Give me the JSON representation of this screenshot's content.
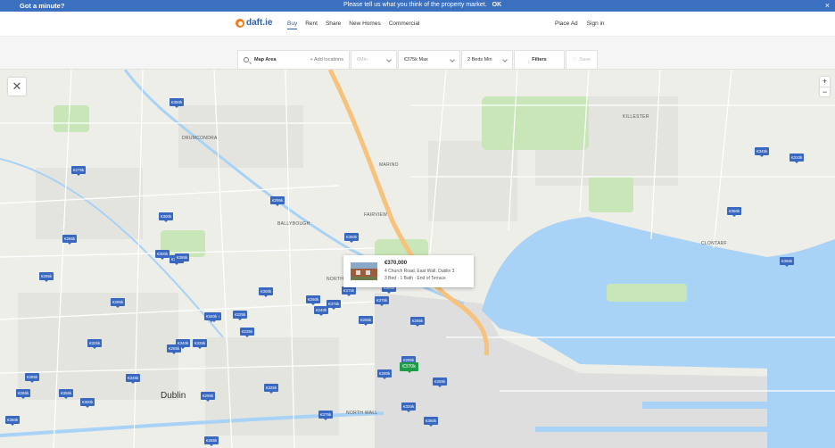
{
  "banner": {
    "left_text": "Got a minute?",
    "message": "Please tell us what you think of the property market.",
    "ok_label": "OK",
    "close_glyph": "×"
  },
  "header": {
    "logo_text": "daft.ie",
    "nav_left": [
      "Buy",
      "Rent",
      "Share",
      "New Homes",
      "Commercial"
    ],
    "nav_right": [
      "Place Ad",
      "Sign in"
    ],
    "active_nav": "Buy"
  },
  "filters": {
    "search_tag": "Map Area",
    "add_locations": "+ Add locations",
    "price_min": "€Min",
    "price_max": "€375k Max",
    "beds_min": "2 Beds Min",
    "filters_label": "Filters",
    "save_label": "Save"
  },
  "map": {
    "close_glyph": "✕",
    "zoom_in": "+",
    "zoom_out": "−",
    "labels": [
      "DRUMCONDRA",
      "MARINO",
      "KILLESTER",
      "FAIRVIEW",
      "BALLYBOUGH",
      "NORTH STRAND",
      "CLONTARF",
      "Dublin",
      "NORTH WALL"
    ],
    "pins": [
      "€350k",
      "€275k",
      "€300k",
      "€265k",
      "€295k",
      "€300k",
      "€375k",
      "€365k",
      "€350k",
      "€310k",
      "€295k",
      "€345k",
      "€300k",
      "€300k",
      "€295k",
      "€260k",
      "€375k",
      "€240k",
      "€375k",
      "€375k",
      "€225k",
      "€265k",
      "€285k",
      "€235k",
      "€260k",
      "€340k",
      "€325k",
      "€265k",
      "€325k",
      "€285k",
      "€345k",
      "€265k",
      "€325k",
      "€355k",
      "€295k",
      "€300k",
      "€280k",
      "€265k",
      "€375k",
      "€350k",
      "€360k",
      "€365k",
      "€350k",
      "€340k",
      "€285k",
      "€265k",
      "€320k"
    ],
    "selected_pin": "€370k"
  },
  "listing": {
    "price": "€370,000",
    "address": "4 Church Road, East Wall, Dublin 3",
    "meta": "3 Bed · 1 Bath · End of Terrace"
  },
  "colors": {
    "brand_blue": "#3868c0",
    "selected_green": "#1e9b46",
    "water": "#a9d3f6",
    "park": "#c9e6b9",
    "main_road": "#f6c27c"
  }
}
